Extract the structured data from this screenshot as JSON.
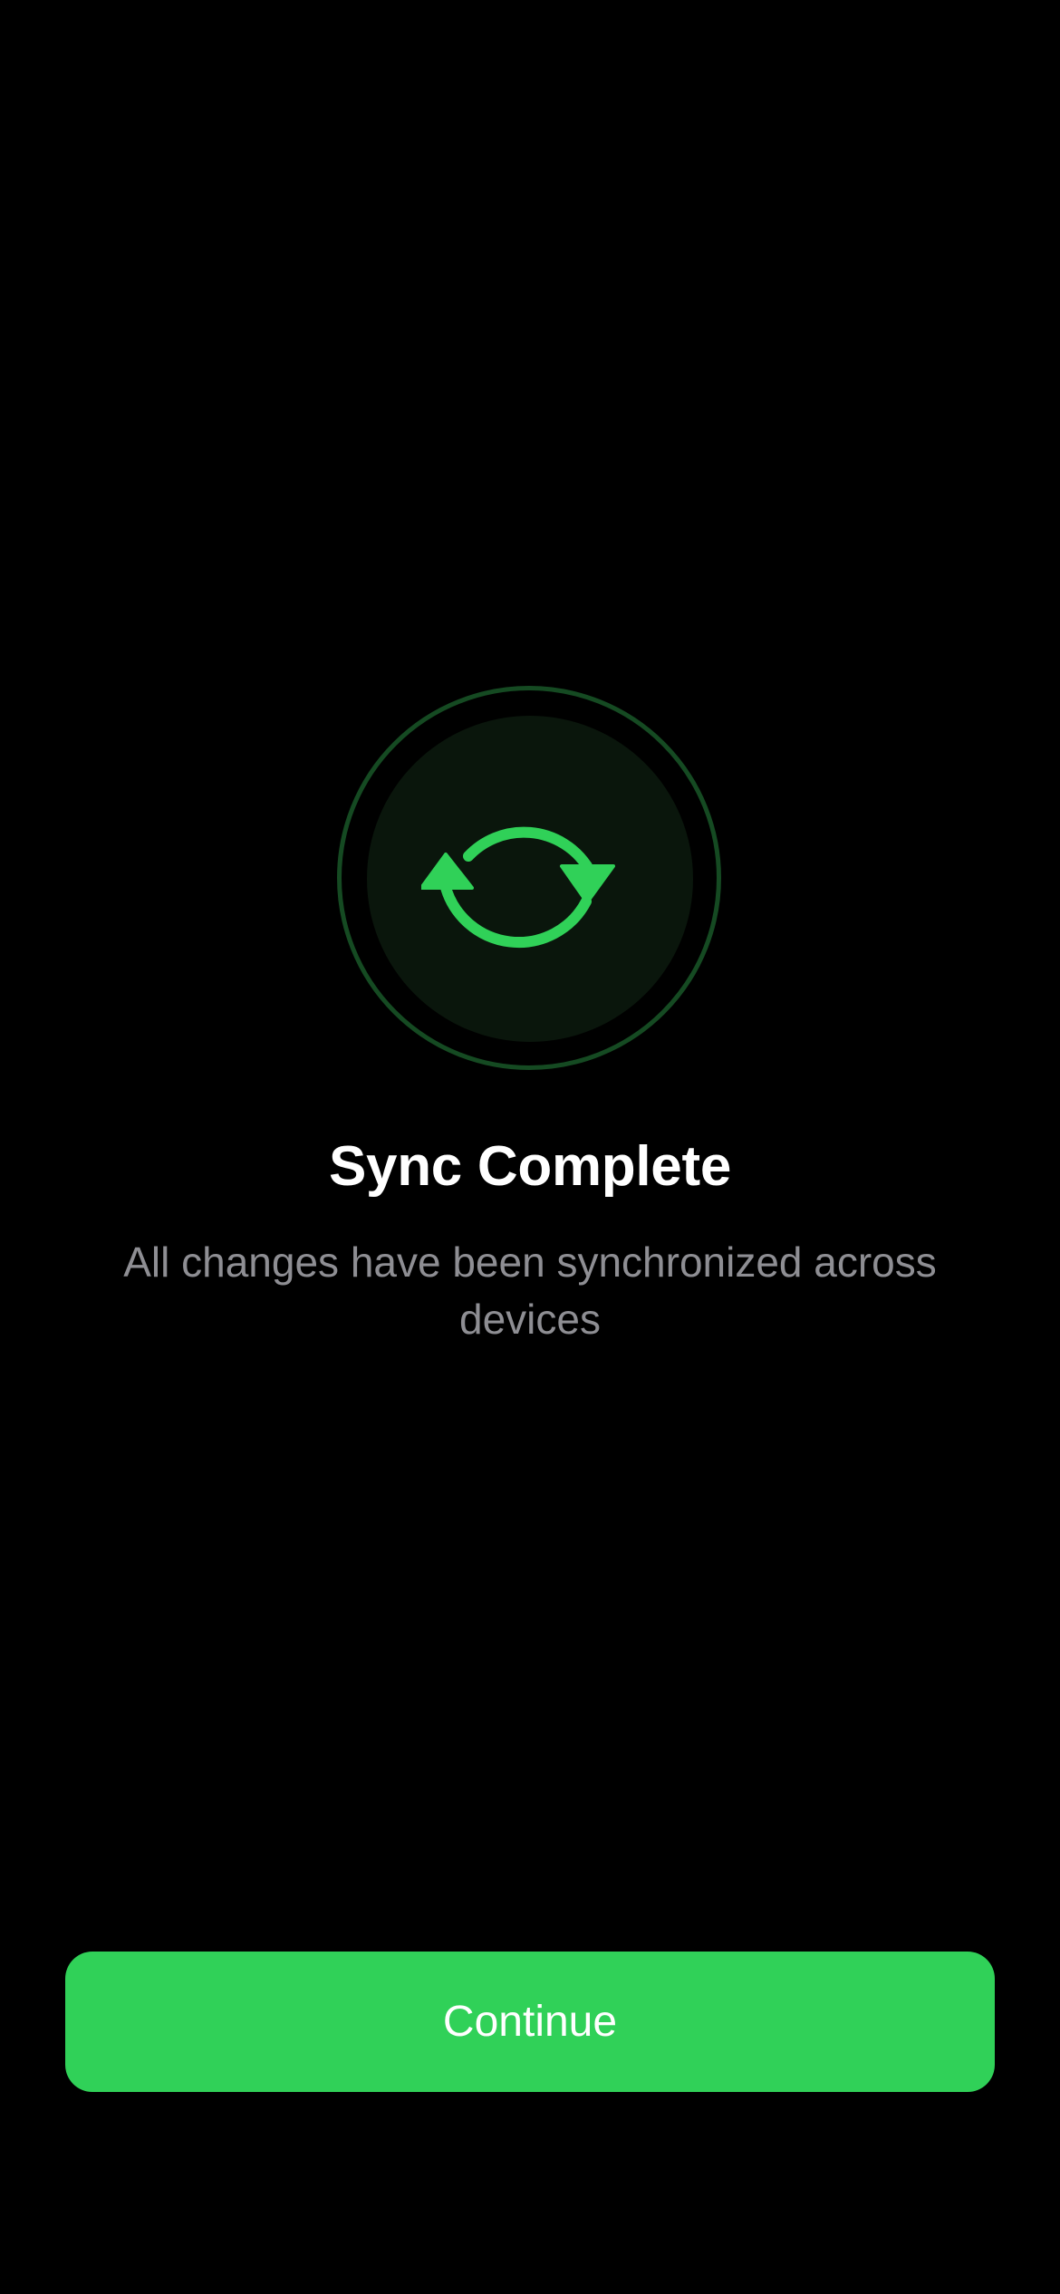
{
  "status": {
    "title": "Sync Complete",
    "message": "All changes have been synchronized across devices",
    "icon": "sync-arrows-icon"
  },
  "actions": {
    "continue_label": "Continue"
  },
  "colors": {
    "accent": "#30d158",
    "background": "#000000",
    "ring": "#154a22",
    "disc": "#0a160c",
    "title": "#ffffff",
    "subtitle": "#8e8e93"
  }
}
